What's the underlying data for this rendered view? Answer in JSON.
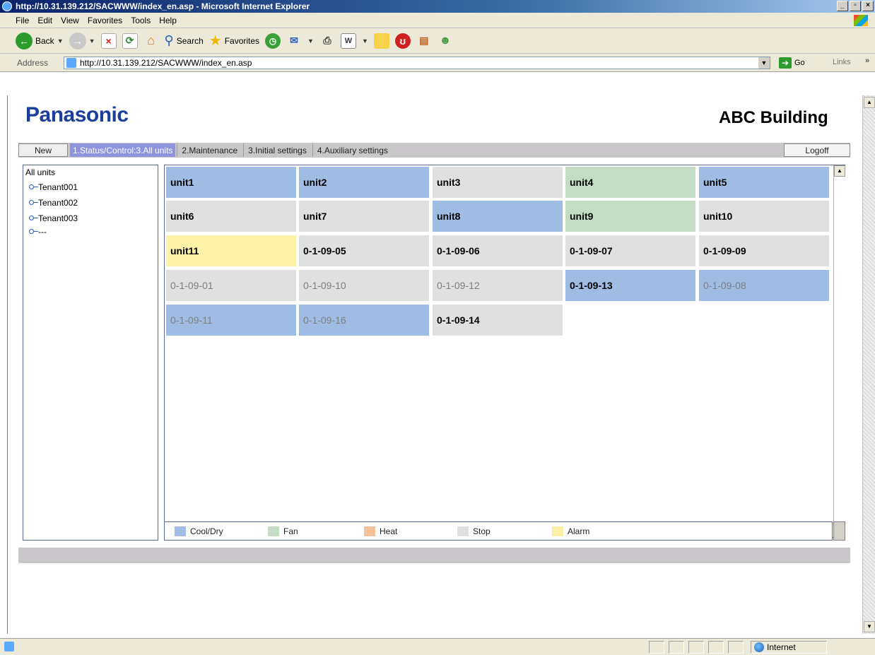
{
  "window": {
    "title": "http://10.31.139.212/SACWWW/index_en.asp - Microsoft Internet Explorer"
  },
  "menu": [
    "File",
    "Edit",
    "View",
    "Favorites",
    "Tools",
    "Help"
  ],
  "toolbar": {
    "back": "Back",
    "search": "Search",
    "favorites": "Favorites"
  },
  "address": {
    "label": "Address",
    "url": "http://10.31.139.212/SACWWW/index_en.asp",
    "go": "Go",
    "links": "Links"
  },
  "header": {
    "logo": "Panasonic",
    "building": "ABC Building"
  },
  "nav": {
    "new": "New",
    "active": "1.Status/Control:3.All units",
    "tabs": [
      "2.Maintenance",
      "3.Initial settings",
      "4.Auxiliary settings"
    ],
    "logoff": "Logoff"
  },
  "tree": {
    "root": "All units",
    "nodes": [
      "Tenant001",
      "Tenant002",
      "Tenant003",
      "---"
    ]
  },
  "units": [
    {
      "label": "unit1",
      "status": "cool",
      "dim": false
    },
    {
      "label": "unit2",
      "status": "cool",
      "dim": false
    },
    {
      "label": "unit3",
      "status": "stop",
      "dim": false
    },
    {
      "label": "unit4",
      "status": "fan",
      "dim": false
    },
    {
      "label": "unit5",
      "status": "cool",
      "dim": false
    },
    {
      "label": "unit6",
      "status": "stop",
      "dim": false
    },
    {
      "label": "unit7",
      "status": "stop",
      "dim": false
    },
    {
      "label": "unit8",
      "status": "cool",
      "dim": false
    },
    {
      "label": "unit9",
      "status": "fan",
      "dim": false
    },
    {
      "label": "unit10",
      "status": "stop",
      "dim": false
    },
    {
      "label": "unit11",
      "status": "alarm",
      "dim": false
    },
    {
      "label": "0-1-09-05",
      "status": "stop",
      "dim": false
    },
    {
      "label": "0-1-09-06",
      "status": "stop",
      "dim": false
    },
    {
      "label": "0-1-09-07",
      "status": "stop",
      "dim": false
    },
    {
      "label": "0-1-09-09",
      "status": "stop",
      "dim": false
    },
    {
      "label": "0-1-09-01",
      "status": "stop",
      "dim": true
    },
    {
      "label": "0-1-09-10",
      "status": "stop",
      "dim": true
    },
    {
      "label": "0-1-09-12",
      "status": "stop",
      "dim": true
    },
    {
      "label": "0-1-09-13",
      "status": "cool",
      "dim": false
    },
    {
      "label": "0-1-09-08",
      "status": "cool",
      "dim": true
    },
    {
      "label": "0-1-09-11",
      "status": "cool",
      "dim": true
    },
    {
      "label": "0-1-09-16",
      "status": "cool",
      "dim": true
    },
    {
      "label": "0-1-09-14",
      "status": "stop",
      "dim": false
    }
  ],
  "legend": [
    {
      "label": "Cool/Dry",
      "color": "#9fbde4"
    },
    {
      "label": "Fan",
      "color": "#c4dcc4"
    },
    {
      "label": "Heat",
      "color": "#f3c29a"
    },
    {
      "label": "Stop",
      "color": "#e0e0e0"
    },
    {
      "label": "Alarm",
      "color": "#fbf2a8"
    }
  ],
  "status": {
    "zone": "Internet"
  }
}
